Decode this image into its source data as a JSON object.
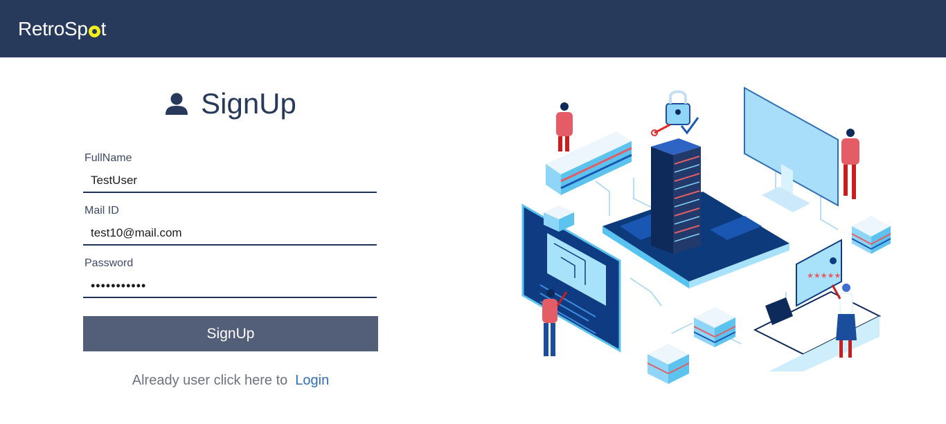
{
  "header": {
    "brand_prefix": "RetroSp",
    "brand_suffix": "t"
  },
  "form": {
    "title": "SignUp",
    "fields": [
      {
        "label": "FullName",
        "value": "TestUser"
      },
      {
        "label": "Mail ID",
        "value": "test10@mail.com"
      },
      {
        "label": "Password",
        "value": "•••••••••••"
      }
    ],
    "submit_label": "SignUp",
    "footer_text": "Already user click here to",
    "login_link": "Login"
  },
  "colors": {
    "header_bg": "#283a5b",
    "logo_dot": "#f4ee1b",
    "button_bg": "#535f78",
    "link": "#2f6fb5"
  },
  "icons": [
    "user-icon"
  ]
}
